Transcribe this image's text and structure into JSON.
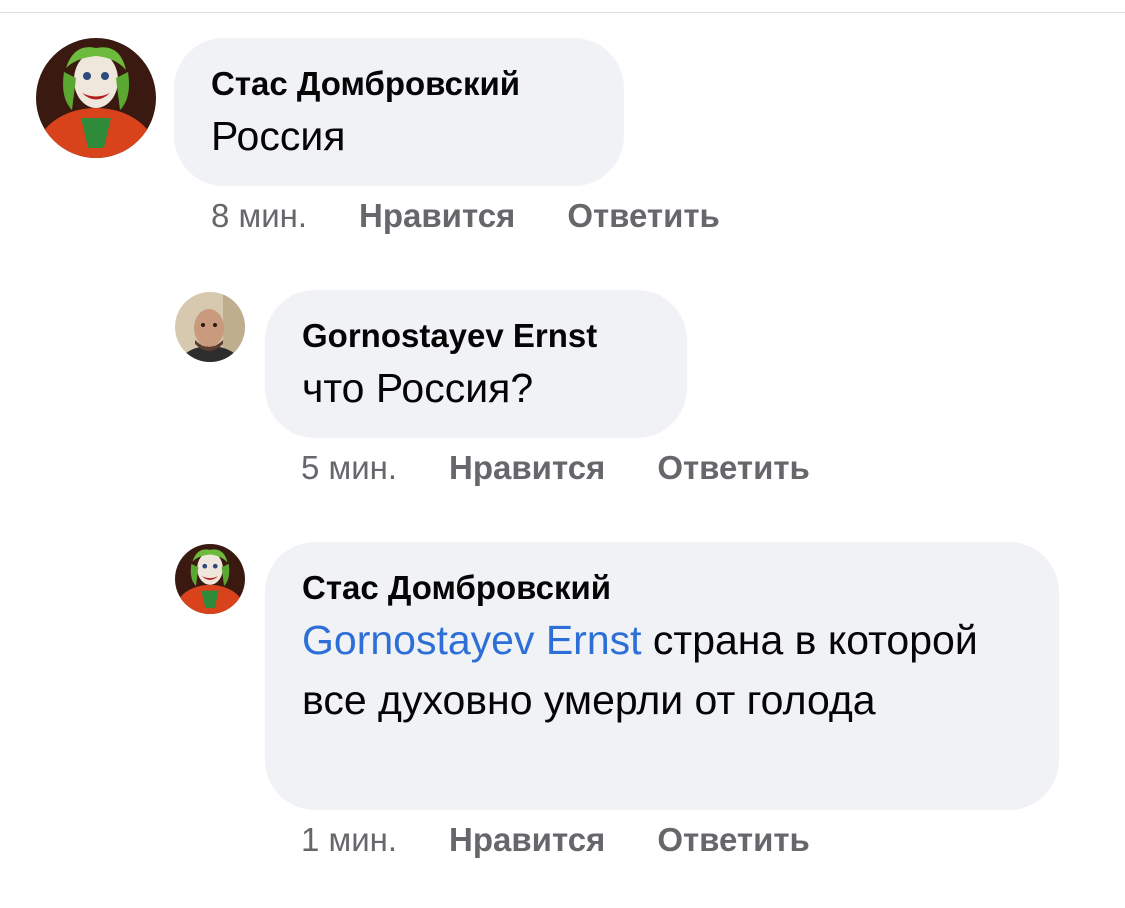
{
  "comments": [
    {
      "author": "Стас Домбровский",
      "text": "Россия",
      "time": "8 мин.",
      "like_label": "Нравится",
      "reply_label": "Ответить",
      "avatar_icon": "joker-avatar"
    },
    {
      "author": "Gornostayev Ernst",
      "text": "что Россия?",
      "time": "5 мин.",
      "like_label": "Нравится",
      "reply_label": "Ответить",
      "avatar_icon": "man-avatar"
    },
    {
      "author": "Стас Домбровский",
      "mention": "Gornostayev Ernst",
      "text": " страна в которой все духовно умерли от голода",
      "time": "1 мин.",
      "like_label": "Нравится",
      "reply_label": "Ответить",
      "avatar_icon": "joker-avatar"
    }
  ],
  "colors": {
    "bubble_bg": "#f0f2f5",
    "text": "#050505",
    "meta": "#65676b",
    "mention": "#2d6fd6"
  }
}
